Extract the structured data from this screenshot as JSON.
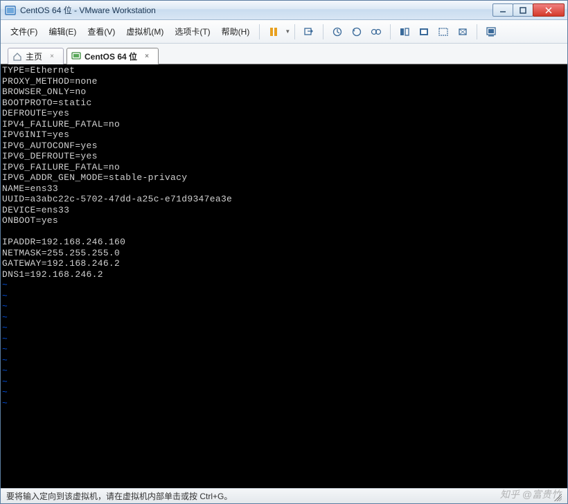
{
  "window": {
    "title": "CentOS 64 位 - VMware Workstation"
  },
  "menu": {
    "file": "文件(F)",
    "edit": "编辑(E)",
    "view": "查看(V)",
    "vm": "虚拟机(M)",
    "tabs": "选项卡(T)",
    "help": "帮助(H)"
  },
  "tabs": {
    "home": "主页",
    "vm": "CentOS 64 位"
  },
  "terminal": {
    "lines": [
      "TYPE=Ethernet",
      "PROXY_METHOD=none",
      "BROWSER_ONLY=no",
      "BOOTPROTO=static",
      "DEFROUTE=yes",
      "IPV4_FAILURE_FATAL=no",
      "IPV6INIT=yes",
      "IPV6_AUTOCONF=yes",
      "IPV6_DEFROUTE=yes",
      "IPV6_FAILURE_FATAL=no",
      "IPV6_ADDR_GEN_MODE=stable-privacy",
      "NAME=ens33",
      "UUID=a3abc22c-5702-47dd-a25c-e71d9347ea3e",
      "DEVICE=ens33",
      "ONBOOT=yes",
      "",
      "IPADDR=192.168.246.160",
      "NETMASK=255.255.255.0",
      "GATEWAY=192.168.246.2",
      "DNS1=192.168.246.2"
    ],
    "tilde_char": "~",
    "tilde_rows": 12
  },
  "statusbar": {
    "text": "要将输入定向到该虚拟机，请在虚拟机内部单击或按 Ctrl+G。"
  },
  "watermark": "知乎 @富贵竹"
}
